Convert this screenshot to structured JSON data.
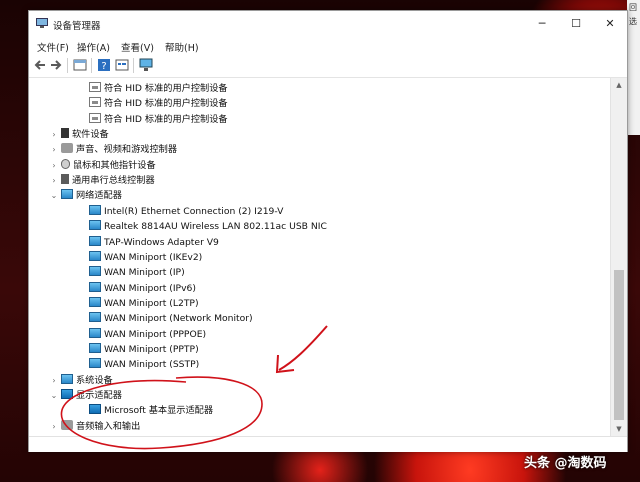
{
  "window": {
    "title": "设备管理器",
    "minimize": "─",
    "maximize": "☐",
    "close": "✕"
  },
  "menu": [
    "文件(F)",
    "操作(A)",
    "查看(V)",
    "帮助(H)"
  ],
  "background_panel": {
    "text1": "回",
    "text2": "选"
  },
  "tree_rows": [
    {
      "label": "符合 HID 标准的用户控制设备",
      "level": 2,
      "icon": "hid-device-icon",
      "expander": ""
    },
    {
      "label": "符合 HID 标准的用户控制设备",
      "level": 2,
      "icon": "hid-device-icon",
      "expander": ""
    },
    {
      "label": "符合 HID 标准的用户控制设备",
      "level": 2,
      "icon": "hid-device-icon",
      "expander": ""
    },
    {
      "label": "软件设备",
      "level": 1,
      "icon": "software-device-icon",
      "expander": "›"
    },
    {
      "label": "声音、视频和游戏控制器",
      "level": 1,
      "icon": "sound-icon",
      "expander": "›"
    },
    {
      "label": "鼠标和其他指针设备",
      "level": 1,
      "icon": "mouse-icon",
      "expander": "›"
    },
    {
      "label": "通用串行总线控制器",
      "level": 1,
      "icon": "usb-icon",
      "expander": "›"
    },
    {
      "label": "网络适配器",
      "level": 1,
      "icon": "network-adapter-icon",
      "expander": "⌄"
    },
    {
      "label": "Intel(R) Ethernet Connection (2) I219-V",
      "level": 2,
      "icon": "network-adapter-icon",
      "expander": ""
    },
    {
      "label": "Realtek 8814AU Wireless LAN 802.11ac USB NIC",
      "level": 2,
      "icon": "network-adapter-icon",
      "expander": ""
    },
    {
      "label": "TAP-Windows Adapter V9",
      "level": 2,
      "icon": "network-adapter-icon",
      "expander": ""
    },
    {
      "label": "WAN Miniport (IKEv2)",
      "level": 2,
      "icon": "network-adapter-icon",
      "expander": ""
    },
    {
      "label": "WAN Miniport (IP)",
      "level": 2,
      "icon": "network-adapter-icon",
      "expander": ""
    },
    {
      "label": "WAN Miniport (IPv6)",
      "level": 2,
      "icon": "network-adapter-icon",
      "expander": ""
    },
    {
      "label": "WAN Miniport (L2TP)",
      "level": 2,
      "icon": "network-adapter-icon",
      "expander": ""
    },
    {
      "label": "WAN Miniport (Network Monitor)",
      "level": 2,
      "icon": "network-adapter-icon",
      "expander": ""
    },
    {
      "label": "WAN Miniport (PPPOE)",
      "level": 2,
      "icon": "network-adapter-icon",
      "expander": ""
    },
    {
      "label": "WAN Miniport (PPTP)",
      "level": 2,
      "icon": "network-adapter-icon",
      "expander": ""
    },
    {
      "label": "WAN Miniport (SSTP)",
      "level": 2,
      "icon": "network-adapter-icon",
      "expander": ""
    },
    {
      "label": "系统设备",
      "level": 1,
      "icon": "system-device-icon",
      "expander": "›"
    },
    {
      "label": "显示适配器",
      "level": 1,
      "icon": "display-adapter-icon",
      "expander": "⌄"
    },
    {
      "label": "Microsoft 基本显示适配器",
      "level": 2,
      "icon": "display-adapter-icon",
      "expander": ""
    },
    {
      "label": "音频输入和输出",
      "level": 1,
      "icon": "audio-io-icon",
      "expander": "›"
    }
  ],
  "watermark": "头条 @淘数码",
  "colors": {
    "annotation": "#d0121a",
    "accent": "#1f6fb4"
  }
}
